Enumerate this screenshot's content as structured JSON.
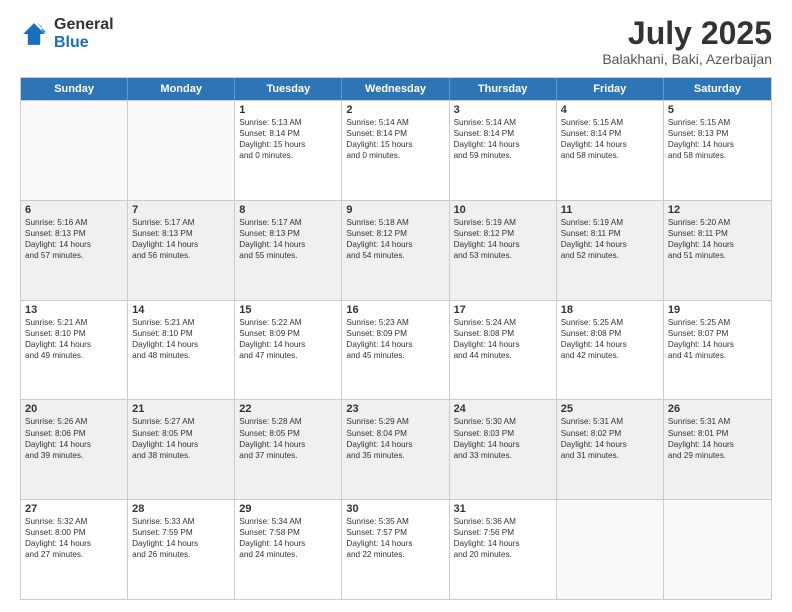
{
  "logo": {
    "general": "General",
    "blue": "Blue"
  },
  "title": "July 2025",
  "subtitle": "Balakhani, Baki, Azerbaijan",
  "headers": [
    "Sunday",
    "Monday",
    "Tuesday",
    "Wednesday",
    "Thursday",
    "Friday",
    "Saturday"
  ],
  "weeks": [
    [
      {
        "day": "",
        "lines": [],
        "empty": true
      },
      {
        "day": "",
        "lines": [],
        "empty": true
      },
      {
        "day": "1",
        "lines": [
          "Sunrise: 5:13 AM",
          "Sunset: 8:14 PM",
          "Daylight: 15 hours",
          "and 0 minutes."
        ],
        "empty": false
      },
      {
        "day": "2",
        "lines": [
          "Sunrise: 5:14 AM",
          "Sunset: 8:14 PM",
          "Daylight: 15 hours",
          "and 0 minutes."
        ],
        "empty": false
      },
      {
        "day": "3",
        "lines": [
          "Sunrise: 5:14 AM",
          "Sunset: 8:14 PM",
          "Daylight: 14 hours",
          "and 59 minutes."
        ],
        "empty": false
      },
      {
        "day": "4",
        "lines": [
          "Sunrise: 5:15 AM",
          "Sunset: 8:14 PM",
          "Daylight: 14 hours",
          "and 58 minutes."
        ],
        "empty": false
      },
      {
        "day": "5",
        "lines": [
          "Sunrise: 5:15 AM",
          "Sunset: 8:13 PM",
          "Daylight: 14 hours",
          "and 58 minutes."
        ],
        "empty": false
      }
    ],
    [
      {
        "day": "6",
        "lines": [
          "Sunrise: 5:16 AM",
          "Sunset: 8:13 PM",
          "Daylight: 14 hours",
          "and 57 minutes."
        ],
        "empty": false
      },
      {
        "day": "7",
        "lines": [
          "Sunrise: 5:17 AM",
          "Sunset: 8:13 PM",
          "Daylight: 14 hours",
          "and 56 minutes."
        ],
        "empty": false
      },
      {
        "day": "8",
        "lines": [
          "Sunrise: 5:17 AM",
          "Sunset: 8:13 PM",
          "Daylight: 14 hours",
          "and 55 minutes."
        ],
        "empty": false
      },
      {
        "day": "9",
        "lines": [
          "Sunrise: 5:18 AM",
          "Sunset: 8:12 PM",
          "Daylight: 14 hours",
          "and 54 minutes."
        ],
        "empty": false
      },
      {
        "day": "10",
        "lines": [
          "Sunrise: 5:19 AM",
          "Sunset: 8:12 PM",
          "Daylight: 14 hours",
          "and 53 minutes."
        ],
        "empty": false
      },
      {
        "day": "11",
        "lines": [
          "Sunrise: 5:19 AM",
          "Sunset: 8:11 PM",
          "Daylight: 14 hours",
          "and 52 minutes."
        ],
        "empty": false
      },
      {
        "day": "12",
        "lines": [
          "Sunrise: 5:20 AM",
          "Sunset: 8:11 PM",
          "Daylight: 14 hours",
          "and 51 minutes."
        ],
        "empty": false
      }
    ],
    [
      {
        "day": "13",
        "lines": [
          "Sunrise: 5:21 AM",
          "Sunset: 8:10 PM",
          "Daylight: 14 hours",
          "and 49 minutes."
        ],
        "empty": false
      },
      {
        "day": "14",
        "lines": [
          "Sunrise: 5:21 AM",
          "Sunset: 8:10 PM",
          "Daylight: 14 hours",
          "and 48 minutes."
        ],
        "empty": false
      },
      {
        "day": "15",
        "lines": [
          "Sunrise: 5:22 AM",
          "Sunset: 8:09 PM",
          "Daylight: 14 hours",
          "and 47 minutes."
        ],
        "empty": false
      },
      {
        "day": "16",
        "lines": [
          "Sunrise: 5:23 AM",
          "Sunset: 8:09 PM",
          "Daylight: 14 hours",
          "and 45 minutes."
        ],
        "empty": false
      },
      {
        "day": "17",
        "lines": [
          "Sunrise: 5:24 AM",
          "Sunset: 8:08 PM",
          "Daylight: 14 hours",
          "and 44 minutes."
        ],
        "empty": false
      },
      {
        "day": "18",
        "lines": [
          "Sunrise: 5:25 AM",
          "Sunset: 8:08 PM",
          "Daylight: 14 hours",
          "and 42 minutes."
        ],
        "empty": false
      },
      {
        "day": "19",
        "lines": [
          "Sunrise: 5:25 AM",
          "Sunset: 8:07 PM",
          "Daylight: 14 hours",
          "and 41 minutes."
        ],
        "empty": false
      }
    ],
    [
      {
        "day": "20",
        "lines": [
          "Sunrise: 5:26 AM",
          "Sunset: 8:06 PM",
          "Daylight: 14 hours",
          "and 39 minutes."
        ],
        "empty": false
      },
      {
        "day": "21",
        "lines": [
          "Sunrise: 5:27 AM",
          "Sunset: 8:05 PM",
          "Daylight: 14 hours",
          "and 38 minutes."
        ],
        "empty": false
      },
      {
        "day": "22",
        "lines": [
          "Sunrise: 5:28 AM",
          "Sunset: 8:05 PM",
          "Daylight: 14 hours",
          "and 37 minutes."
        ],
        "empty": false
      },
      {
        "day": "23",
        "lines": [
          "Sunrise: 5:29 AM",
          "Sunset: 8:04 PM",
          "Daylight: 14 hours",
          "and 35 minutes."
        ],
        "empty": false
      },
      {
        "day": "24",
        "lines": [
          "Sunrise: 5:30 AM",
          "Sunset: 8:03 PM",
          "Daylight: 14 hours",
          "and 33 minutes."
        ],
        "empty": false
      },
      {
        "day": "25",
        "lines": [
          "Sunrise: 5:31 AM",
          "Sunset: 8:02 PM",
          "Daylight: 14 hours",
          "and 31 minutes."
        ],
        "empty": false
      },
      {
        "day": "26",
        "lines": [
          "Sunrise: 5:31 AM",
          "Sunset: 8:01 PM",
          "Daylight: 14 hours",
          "and 29 minutes."
        ],
        "empty": false
      }
    ],
    [
      {
        "day": "27",
        "lines": [
          "Sunrise: 5:32 AM",
          "Sunset: 8:00 PM",
          "Daylight: 14 hours",
          "and 27 minutes."
        ],
        "empty": false
      },
      {
        "day": "28",
        "lines": [
          "Sunrise: 5:33 AM",
          "Sunset: 7:59 PM",
          "Daylight: 14 hours",
          "and 26 minutes."
        ],
        "empty": false
      },
      {
        "day": "29",
        "lines": [
          "Sunrise: 5:34 AM",
          "Sunset: 7:58 PM",
          "Daylight: 14 hours",
          "and 24 minutes."
        ],
        "empty": false
      },
      {
        "day": "30",
        "lines": [
          "Sunrise: 5:35 AM",
          "Sunset: 7:57 PM",
          "Daylight: 14 hours",
          "and 22 minutes."
        ],
        "empty": false
      },
      {
        "day": "31",
        "lines": [
          "Sunrise: 5:36 AM",
          "Sunset: 7:56 PM",
          "Daylight: 14 hours",
          "and 20 minutes."
        ],
        "empty": false
      },
      {
        "day": "",
        "lines": [],
        "empty": true
      },
      {
        "day": "",
        "lines": [],
        "empty": true
      }
    ]
  ]
}
